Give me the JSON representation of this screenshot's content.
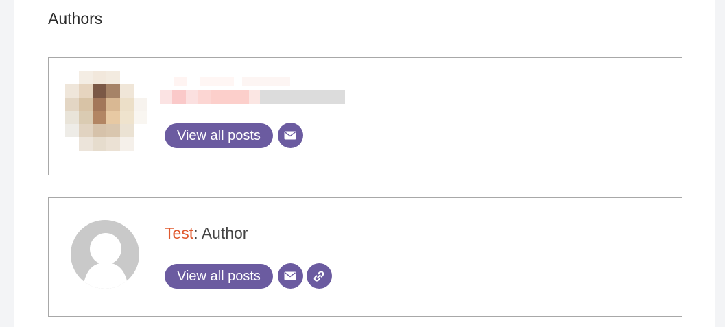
{
  "section": {
    "title": "Authors"
  },
  "authors": [
    {
      "name_redacted": true,
      "avatar": "pixelated-photo",
      "view_posts_label": "View all posts",
      "icons": [
        "envelope-icon"
      ]
    },
    {
      "name": "Test",
      "name_separator": ":",
      "role": "Author",
      "avatar": "default-user-silhouette",
      "view_posts_label": "View all posts",
      "icons": [
        "envelope-icon",
        "link-icon"
      ]
    }
  ],
  "colors": {
    "accent_button": "#6b5ba0",
    "author_name": "#e05a2f",
    "card_border": "#a8a8a8",
    "page_background": "#f3f4f6"
  }
}
